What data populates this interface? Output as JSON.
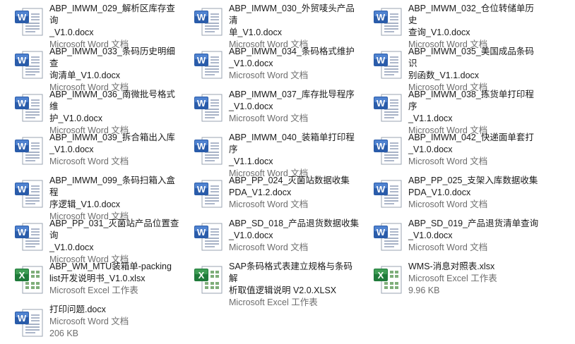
{
  "files": [
    {
      "name1": "ABP_IMWM_029_解析区库存查询",
      "name2": "_V1.0.docx",
      "type": "Microsoft Word 文档",
      "size": "",
      "icon": "word-doc-icon"
    },
    {
      "name1": "ABP_IMWM_030_外贸唛头产品清",
      "name2": "单_V1.0.docx",
      "type": "Microsoft Word 文档",
      "size": "",
      "icon": "word-doc-icon"
    },
    {
      "name1": "ABP_IMWM_032_仓位转储单历史",
      "name2": "查询_V1.0.docx",
      "type": "Microsoft Word 文档",
      "size": "",
      "icon": "word-doc-icon"
    },
    {
      "name1": "ABP_IMWM_033_条码历史明细查",
      "name2": "询清单_V1.0.docx",
      "type": "Microsoft Word 文档",
      "size": "",
      "icon": "word-doc-icon"
    },
    {
      "name1": "ABP_IMWM_034_条码格式维护",
      "name2": "_V1.0.docx",
      "type": "Microsoft Word 文档",
      "size": "",
      "icon": "word-doc-icon"
    },
    {
      "name1": "ABP_IMWM_035_美国成品条码识",
      "name2": "别函数_V1.1.docx",
      "type": "Microsoft Word 文档",
      "size": "",
      "icon": "word-doc-icon"
    },
    {
      "name1": "ABP_IMWM_036_南微批号格式维",
      "name2": "护_V1.0.docx",
      "type": "Microsoft Word 文档",
      "size": "",
      "icon": "word-doc-icon"
    },
    {
      "name1": "ABP_IMWM_037_库存批导程序",
      "name2": "_V1.0.docx",
      "type": "Microsoft Word 文档",
      "size": "",
      "icon": "word-doc-icon"
    },
    {
      "name1": "ABP_IMWM_038_拣货单打印程序",
      "name2": "_V1.1.docx",
      "type": "Microsoft Word 文档",
      "size": "",
      "icon": "word-doc-icon"
    },
    {
      "name1": "ABP_IMWM_039_拆合箱出入库",
      "name2": "_V1.0.docx",
      "type": "Microsoft Word 文档",
      "size": "",
      "icon": "word-doc-icon"
    },
    {
      "name1": "ABP_IMWM_040_装箱单打印程序",
      "name2": "_V1.1.docx",
      "type": "Microsoft Word 文档",
      "size": "",
      "icon": "word-doc-icon"
    },
    {
      "name1": "ABP_IMWM_042_快递面单套打",
      "name2": "_V1.0.docx",
      "type": "Microsoft Word 文档",
      "size": "",
      "icon": "word-doc-icon"
    },
    {
      "name1": "ABP_IMWM_099_条码扫箱入盒程",
      "name2": "序逻辑_V1.0.docx",
      "type": "Microsoft Word 文档",
      "size": "",
      "icon": "word-doc-icon"
    },
    {
      "name1": "ABP_PP_024_灭菌站数据收集",
      "name2": "PDA_V1.2.docx",
      "type": "Microsoft Word 文档",
      "size": "",
      "icon": "word-doc-icon"
    },
    {
      "name1": "ABP_PP_025_支架入库数据收集",
      "name2": "PDA_V1.0.docx",
      "type": "Microsoft Word 文档",
      "size": "",
      "icon": "word-doc-icon"
    },
    {
      "name1": "ABP_PP_031_灭菌站产品位置查询",
      "name2": "_V1.0.docx",
      "type": "Microsoft Word 文档",
      "size": "",
      "icon": "word-doc-icon"
    },
    {
      "name1": "ABP_SD_018_产品退货数据收集",
      "name2": "_V1.0.docx",
      "type": "Microsoft Word 文档",
      "size": "",
      "icon": "word-doc-icon"
    },
    {
      "name1": "ABP_SD_019_产品退货清单查询",
      "name2": "_V1.0.docx",
      "type": "Microsoft Word 文档",
      "size": "",
      "icon": "word-doc-icon"
    },
    {
      "name1": "ABP_WM_MTU装箱单-packing",
      "name2": "list开发说明书_V1.0.xlsx",
      "type": "Microsoft Excel 工作表",
      "size": "",
      "icon": "excel-sheet-icon"
    },
    {
      "name1": "SAP条码格式表建立规格与条码解",
      "name2": "析取值逻辑说明 V2.0.XLSX",
      "type": "Microsoft Excel 工作表",
      "size": "",
      "icon": "excel-sheet-icon"
    },
    {
      "name1": "WMS-消息对照表.xlsx",
      "name2": "",
      "type": "Microsoft Excel 工作表",
      "size": "9.96 KB",
      "icon": "excel-sheet-icon"
    },
    {
      "name1": "打印问题.docx",
      "name2": "",
      "type": "Microsoft Word 文档",
      "size": "206 KB",
      "icon": "word-doc-icon"
    }
  ]
}
